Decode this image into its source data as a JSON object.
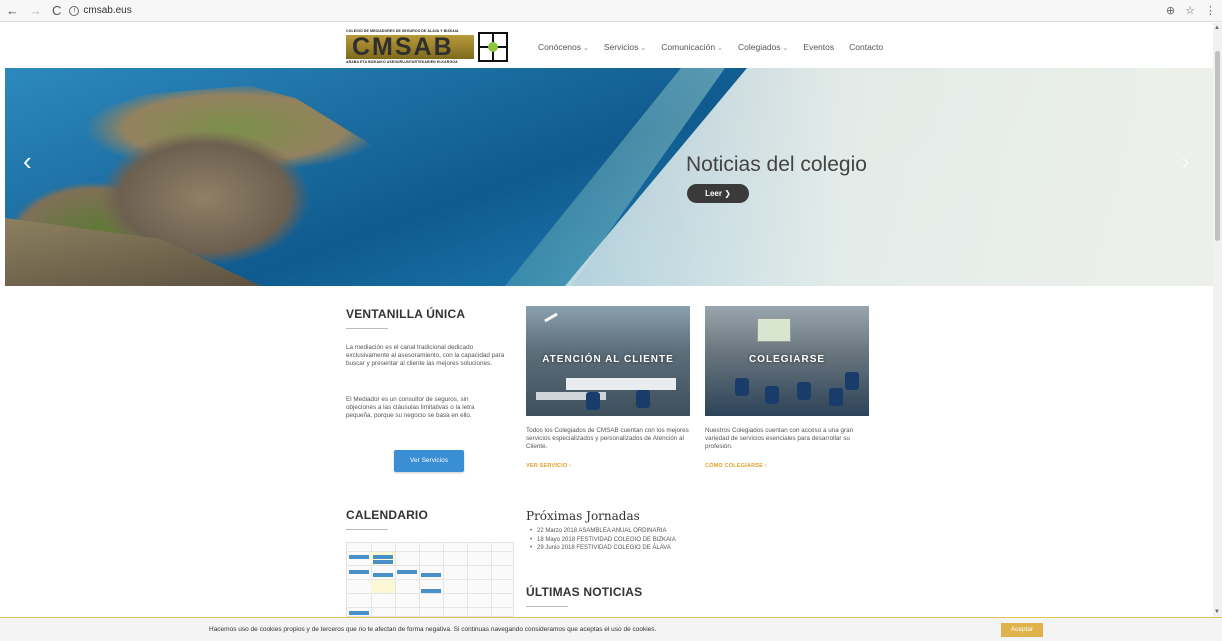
{
  "browser": {
    "back": "←",
    "forward": "→",
    "reload": "C",
    "info": "i",
    "url": "cmsab.eus",
    "zoom_icon": "⊕",
    "star_icon": "☆",
    "menu_icon": "⋮"
  },
  "logo": {
    "top_line": "COLEGIO DE MEDIADORES DE SEGUROS DE ÁLAVA Y BIZKAIA",
    "wordmark": "CMSAB",
    "bottom_line": "ARABA ETA BIZKAIKO ASEGURU-BITARTEKARIEN ELKARGOA"
  },
  "menu": {
    "items": [
      {
        "label": "Conócenos",
        "chevron": "⌄"
      },
      {
        "label": "Servicios",
        "chevron": "⌄"
      },
      {
        "label": "Comunicación",
        "chevron": "⌄"
      },
      {
        "label": "Colegiados",
        "chevron": "⌄"
      },
      {
        "label": "Eventos",
        "chevron": ""
      },
      {
        "label": "Contacto",
        "chevron": ""
      }
    ]
  },
  "hero": {
    "title": "Noticias del colegio",
    "button": "Leer ❯",
    "prev": "‹",
    "next": "›"
  },
  "ventanilla": {
    "title": "VENTANILLA ÚNICA",
    "p1": "La mediación es el canal tradicional dedicado exclusivamente al asesoramiento, con la capacidad para buscar y presentar al cliente las mejores soluciones.",
    "p2": "El Mediador es un consultor de seguros, sin objeciones a las cláusulas limitativas o la letra pequeña, porque su negocio se basa en ello.",
    "button": "Ver Servicios"
  },
  "cards": [
    {
      "label": "ATENCIÓN AL CLIENTE",
      "text": "Todos los Colegiados de CMSAB cuentan con los mejores servicios especializados y personalizados de Atención al Cliente.",
      "link": "VER SERVICIO ›"
    },
    {
      "label": "COLEGIARSE",
      "text": "Nuestros Colegiados cuentan con acceso a una gran variedad de servicios esenciales para desarrollar su profesión.",
      "link": "CÓMO COLEGIARSE ›"
    }
  ],
  "calendario": {
    "title": "CALENDARIO"
  },
  "jornadas": {
    "title": "Próximas Jornadas",
    "items": [
      "22 Marzo 2018 ASAMBLEA ANUAL ORDINARIA",
      "18 Mayo 2018 FESTIVIDAD COLEGIO DE BIZKAIA",
      "29 Junio 2018 FESTIVIDAD COLEGIO DE ÁLAVA"
    ]
  },
  "noticias": {
    "title": "ÚLTIMAS NOTICIAS"
  },
  "cookie": {
    "message": "Hacemos uso de cookies propios y de terceros que no te afectan de forma negativa. Si continuas navegando consideramos que aceptas el uso de cookies.",
    "accept": "Aceptar"
  },
  "colors": {
    "accent_blue": "#3a8ed4",
    "link_gold": "#e0a02a",
    "cookie_button": "#e0b34a",
    "hero_button": "#3a3a3a"
  }
}
